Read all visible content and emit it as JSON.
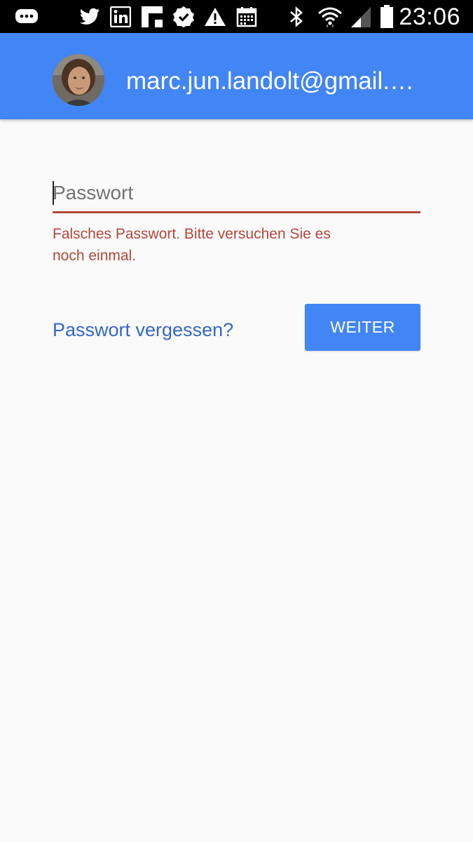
{
  "status_bar": {
    "time": "23:06",
    "icons": [
      "messenger-icon",
      "twitter-icon",
      "linkedin-icon",
      "flipboard-icon",
      "check-badge-icon",
      "warning-icon",
      "calendar-icon",
      "bluetooth-icon",
      "wifi-icon",
      "signal-icon",
      "battery-icon"
    ]
  },
  "account": {
    "email": "marc.jun.landolt@gmail.com"
  },
  "form": {
    "password_placeholder": "Passwort",
    "password_value": "",
    "error_message": "Falsches Passwort. Bitte versuchen Sie es noch einmal.",
    "forgot_link": "Passwort vergessen?",
    "next_button": "WEITER"
  },
  "colors": {
    "header": "#4285f4",
    "button": "#4285f4",
    "error": "#b3473a",
    "link": "#3367c8",
    "background": "#fafafa"
  }
}
